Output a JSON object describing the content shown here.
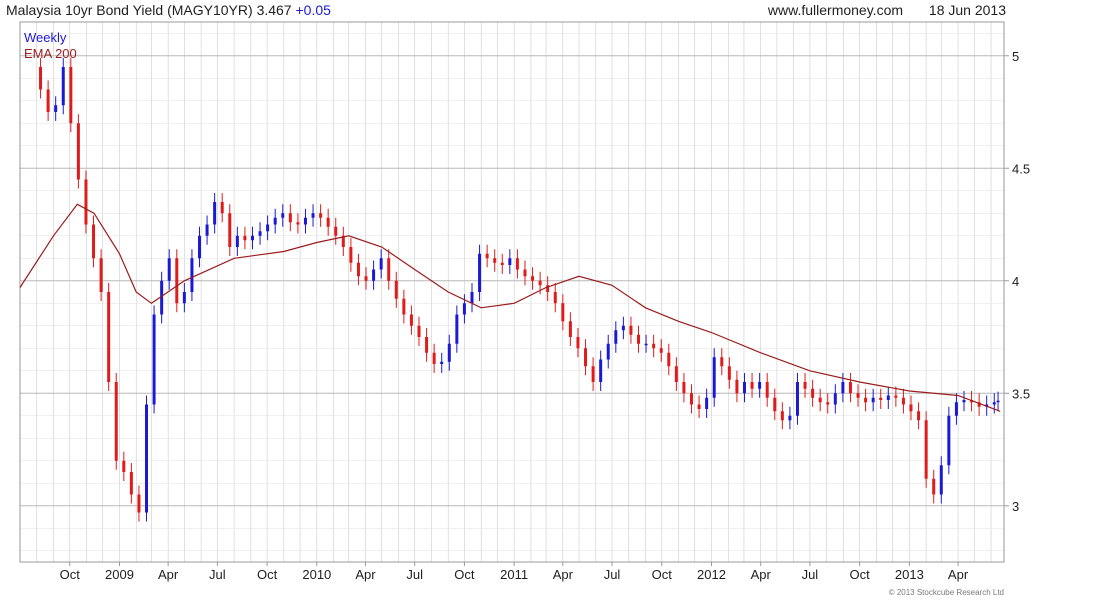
{
  "header": {
    "name": "Malaysia 10yr Bond Yield (MAGY10YR)",
    "last": "3.467",
    "change": "+0.05",
    "source": "www.fullermoney.com",
    "date": "18 Jun 2013"
  },
  "legend": {
    "period": "Weekly",
    "indicator": "EMA 200"
  },
  "footer": {
    "copyright": "© 2013 Stockcube Research Ltd"
  },
  "colors": {
    "up": "#1a1ad6",
    "down": "#e01b1b",
    "ema": "#9b1c1c",
    "grid": "#cccccc"
  },
  "chart_data": {
    "type": "line",
    "title": "Malaysia 10yr Bond Yield (MAGY10YR)",
    "ylim": [
      2.75,
      5.15
    ],
    "y_ticks": [
      3,
      3.5,
      4,
      4.5,
      5
    ],
    "y_tick_labels": [
      "3",
      "3.5",
      "4",
      "4.5",
      "5"
    ],
    "x_tick_labels": [
      "Oct",
      "2009",
      "Apr",
      "Jul",
      "Oct",
      "2010",
      "Apr",
      "Jul",
      "Oct",
      "2011",
      "Apr",
      "Jul",
      "Oct",
      "2012",
      "Apr",
      "Jul",
      "Oct",
      "2013",
      "Apr"
    ],
    "grid": true,
    "legend_position": "top-left",
    "series": [
      {
        "name": "Weekly",
        "x": [
          "2008-07-25",
          "2008-08-08",
          "2008-08-22",
          "2008-09-05",
          "2008-09-19",
          "2008-10-03",
          "2008-10-17",
          "2008-10-31",
          "2008-11-14",
          "2008-11-28",
          "2008-12-12",
          "2008-12-26",
          "2009-01-09",
          "2009-01-23",
          "2009-02-06",
          "2009-02-20",
          "2009-03-06",
          "2009-03-20",
          "2009-04-03",
          "2009-04-17",
          "2009-05-01",
          "2009-05-15",
          "2009-05-29",
          "2009-06-12",
          "2009-06-26",
          "2009-07-10",
          "2009-07-24",
          "2009-08-07",
          "2009-08-21",
          "2009-09-04",
          "2009-09-18",
          "2009-10-02",
          "2009-10-16",
          "2009-10-30",
          "2009-11-13",
          "2009-11-27",
          "2009-12-11",
          "2009-12-25",
          "2010-01-08",
          "2010-01-22",
          "2010-02-05",
          "2010-02-19",
          "2010-03-05",
          "2010-03-19",
          "2010-04-02",
          "2010-04-16",
          "2010-04-30",
          "2010-05-14",
          "2010-05-28",
          "2010-06-11",
          "2010-06-25",
          "2010-07-09",
          "2010-07-23",
          "2010-08-06",
          "2010-08-20",
          "2010-09-03",
          "2010-09-17",
          "2010-10-01",
          "2010-10-15",
          "2010-10-29",
          "2010-11-12",
          "2010-11-26",
          "2010-12-10",
          "2010-12-24",
          "2011-01-07",
          "2011-01-21",
          "2011-02-04",
          "2011-02-18",
          "2011-03-04",
          "2011-03-18",
          "2011-04-01",
          "2011-04-15",
          "2011-04-29",
          "2011-05-13",
          "2011-05-27",
          "2011-06-10",
          "2011-06-24",
          "2011-07-08",
          "2011-07-22",
          "2011-08-05",
          "2011-08-19",
          "2011-09-02",
          "2011-09-16",
          "2011-09-30",
          "2011-10-14",
          "2011-10-28",
          "2011-11-11",
          "2011-11-25",
          "2011-12-09",
          "2011-12-23",
          "2012-01-06",
          "2012-01-20",
          "2012-02-03",
          "2012-02-17",
          "2012-03-02",
          "2012-03-16",
          "2012-03-30",
          "2012-04-13",
          "2012-04-27",
          "2012-05-11",
          "2012-05-25",
          "2012-06-08",
          "2012-06-22",
          "2012-07-06",
          "2012-07-20",
          "2012-08-03",
          "2012-08-17",
          "2012-08-31",
          "2012-09-14",
          "2012-09-28",
          "2012-10-12",
          "2012-10-26",
          "2012-11-09",
          "2012-11-23",
          "2012-12-07",
          "2012-12-21",
          "2013-01-04",
          "2013-01-18",
          "2013-02-01",
          "2013-02-15",
          "2013-03-01",
          "2013-03-15",
          "2013-03-29",
          "2013-04-12",
          "2013-04-26",
          "2013-05-10",
          "2013-05-24",
          "2013-06-07",
          "2013-06-14"
        ],
        "y": [
          4.95,
          4.85,
          4.75,
          4.78,
          4.95,
          4.7,
          4.45,
          4.25,
          4.1,
          3.95,
          3.55,
          3.2,
          3.15,
          3.05,
          2.97,
          3.45,
          3.85,
          4.0,
          4.1,
          3.9,
          3.95,
          4.1,
          4.2,
          4.25,
          4.35,
          4.3,
          4.15,
          4.2,
          4.18,
          4.2,
          4.22,
          4.25,
          4.28,
          4.3,
          4.26,
          4.25,
          4.28,
          4.3,
          4.28,
          4.24,
          4.2,
          4.15,
          4.08,
          4.02,
          4.0,
          4.05,
          4.1,
          4.0,
          3.92,
          3.85,
          3.8,
          3.75,
          3.68,
          3.63,
          3.64,
          3.72,
          3.85,
          3.9,
          3.95,
          4.12,
          4.1,
          4.08,
          4.07,
          4.1,
          4.05,
          4.02,
          4.0,
          3.98,
          3.95,
          3.9,
          3.82,
          3.75,
          3.7,
          3.62,
          3.55,
          3.65,
          3.72,
          3.78,
          3.8,
          3.76,
          3.72,
          3.72,
          3.7,
          3.68,
          3.62,
          3.55,
          3.5,
          3.45,
          3.43,
          3.48,
          3.66,
          3.62,
          3.56,
          3.5,
          3.55,
          3.52,
          3.55,
          3.48,
          3.42,
          3.38,
          3.4,
          3.55,
          3.52,
          3.48,
          3.46,
          3.45,
          3.5,
          3.55,
          3.5,
          3.48,
          3.46,
          3.48,
          3.47,
          3.49,
          3.48,
          3.45,
          3.42,
          3.38,
          3.12,
          3.05,
          3.18,
          3.4,
          3.46,
          3.47,
          3.46,
          3.44,
          3.45,
          3.46,
          3.467
        ]
      },
      {
        "name": "EMA 200",
        "x": [
          "2008-07-01",
          "2008-09-01",
          "2008-10-15",
          "2008-11-15",
          "2009-01-01",
          "2009-02-01",
          "2009-03-01",
          "2009-05-01",
          "2009-08-01",
          "2009-11-01",
          "2010-01-01",
          "2010-03-01",
          "2010-05-01",
          "2010-07-01",
          "2010-09-01",
          "2010-11-01",
          "2011-01-01",
          "2011-03-01",
          "2011-05-01",
          "2011-07-01",
          "2011-09-01",
          "2011-11-01",
          "2012-01-01",
          "2012-04-01",
          "2012-07-01",
          "2012-10-01",
          "2013-01-01",
          "2013-04-01",
          "2013-06-18"
        ],
        "y": [
          3.97,
          4.2,
          4.34,
          4.3,
          4.12,
          3.95,
          3.9,
          4.0,
          4.1,
          4.13,
          4.17,
          4.2,
          4.15,
          4.05,
          3.95,
          3.88,
          3.9,
          3.97,
          4.02,
          3.98,
          3.88,
          3.82,
          3.77,
          3.68,
          3.6,
          3.55,
          3.51,
          3.49,
          3.42
        ]
      }
    ]
  }
}
